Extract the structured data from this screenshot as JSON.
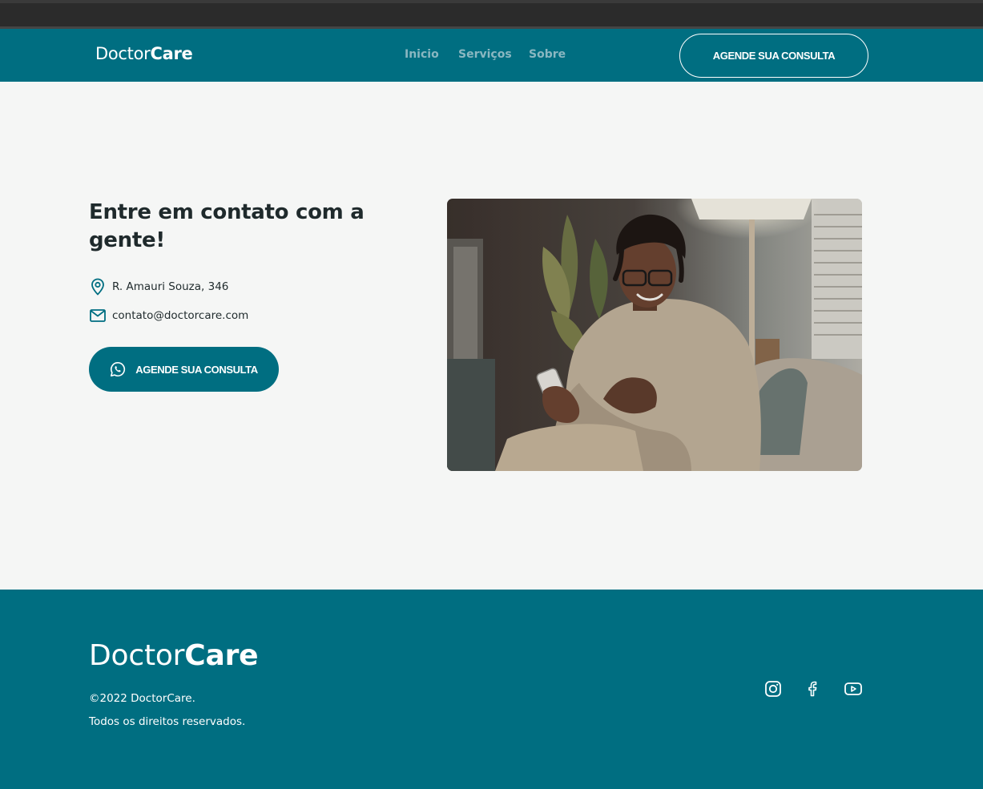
{
  "nav": {
    "logo_regular": "Doctor",
    "logo_bold": "Care",
    "links": [
      {
        "label": "Inicio"
      },
      {
        "label": "Serviços"
      },
      {
        "label": "Sobre"
      }
    ],
    "cta_label": "AGENDE SUA CONSULTA"
  },
  "contact": {
    "title": "Entre em contato com a gente!",
    "address": "R. Amauri Souza, 346",
    "email": "contato@doctorcare.com",
    "cta_label": "AGENDE SUA CONSULTA",
    "address_icon": "map-pin-icon",
    "email_icon": "mail-icon",
    "cta_icon": "whatsapp-icon"
  },
  "footer": {
    "logo_regular": "Doctor",
    "logo_bold": "Care",
    "copyright": "©2022 DoctorCare.",
    "rights": "Todos os direitos reservados.",
    "social_icons": [
      "instagram-icon",
      "facebook-icon",
      "youtube-icon"
    ]
  },
  "colors": {
    "brand": "#006e81",
    "background": "#f5f6f5",
    "text_dark": "#1f2a2c",
    "nav_link": "#8ab7c1"
  }
}
